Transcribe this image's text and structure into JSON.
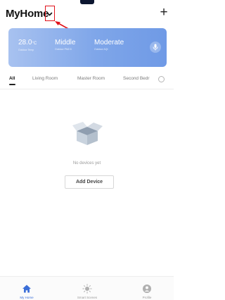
{
  "header": {
    "title": "MyHome",
    "add_label": "+"
  },
  "weather": {
    "items": [
      {
        "value": "28.0",
        "unit": "°C",
        "label": "Outdoor Temp"
      },
      {
        "value": "Middle",
        "unit": "",
        "label": "Outdoor PM2.5"
      },
      {
        "value": "Moderate",
        "unit": "",
        "label": "Outdoor AQI"
      }
    ]
  },
  "tabs": [
    {
      "label": "All",
      "active": true
    },
    {
      "label": "Living Room",
      "active": false
    },
    {
      "label": "Master Room",
      "active": false
    },
    {
      "label": "Second Bedr",
      "active": false
    }
  ],
  "empty_state": {
    "message": "No devices yet",
    "button": "Add Device"
  },
  "bottom_nav": [
    {
      "label": "My Home",
      "icon": "home-icon",
      "active": true
    },
    {
      "label": "Smart Scenes",
      "icon": "sun-icon",
      "active": false
    },
    {
      "label": "Profile",
      "icon": "profile-icon",
      "active": false
    }
  ],
  "colors": {
    "annotation_red": "#e0121b",
    "card_gradient_start": "#a8c2f0",
    "card_gradient_end": "#6f9ae6",
    "active_nav": "#3c6fd8"
  }
}
